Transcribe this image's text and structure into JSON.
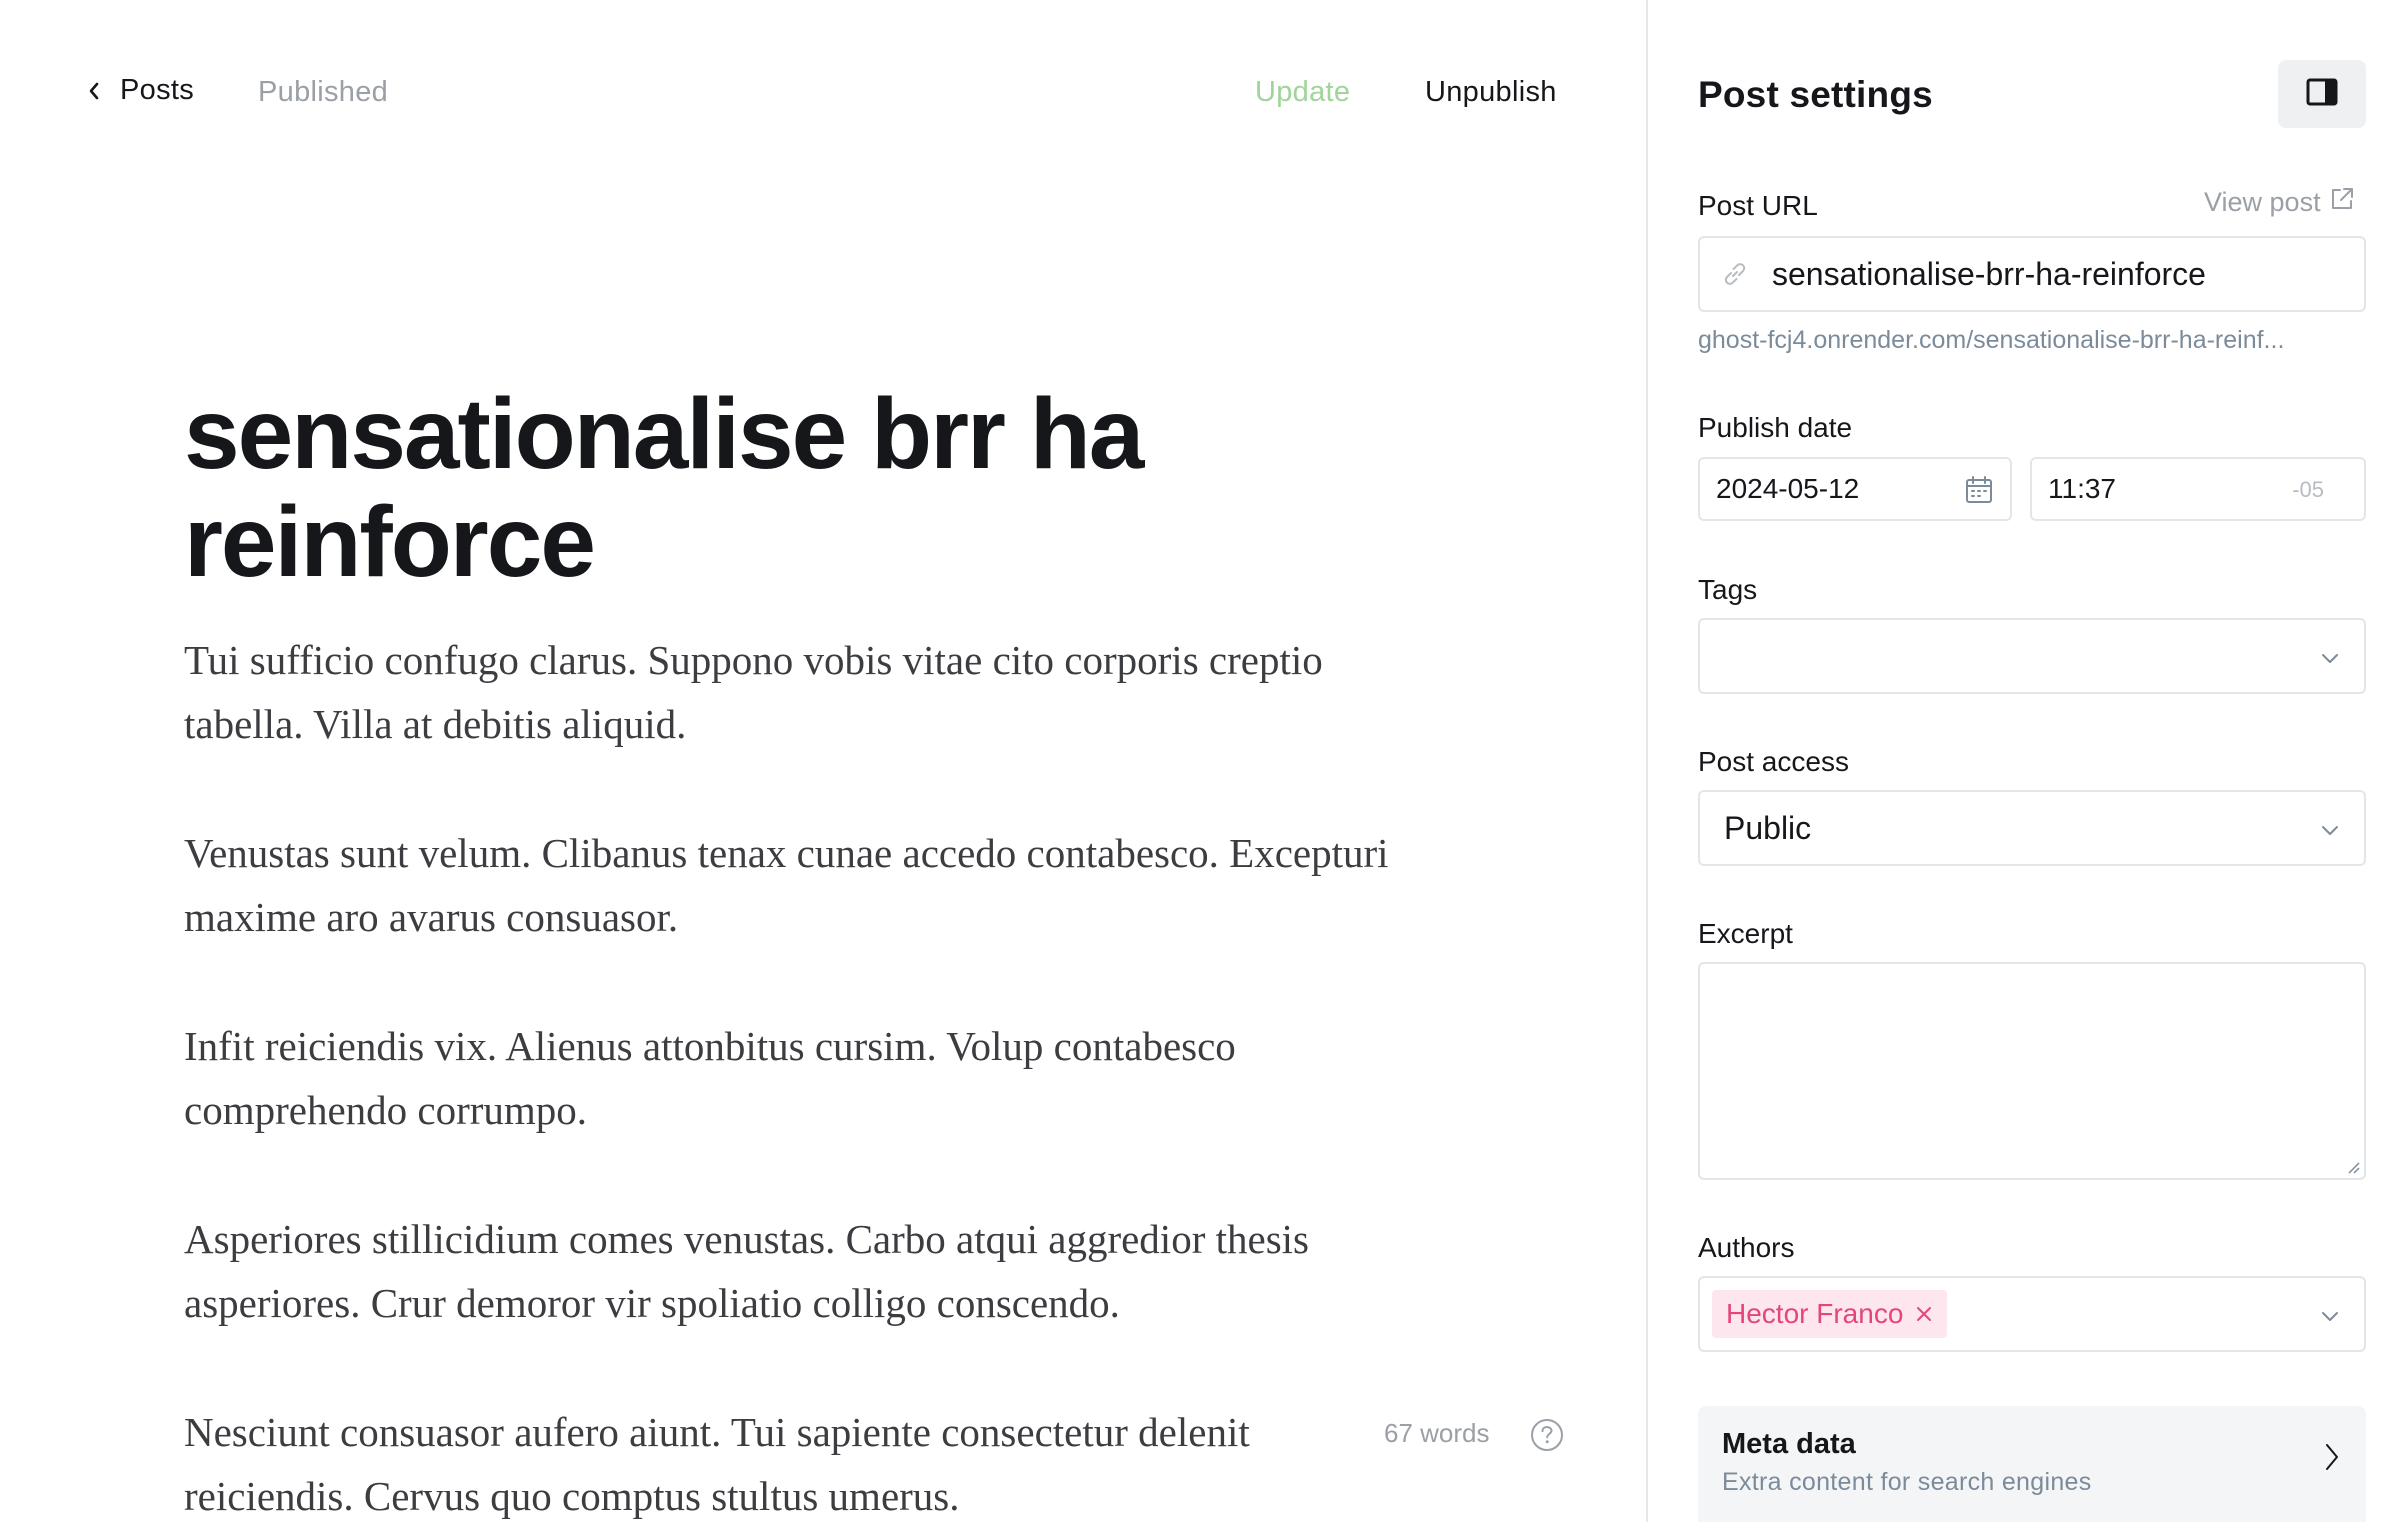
{
  "header": {
    "back_label": "Posts",
    "status": "Published",
    "update_label": "Update",
    "unpublish_label": "Unpublish"
  },
  "post": {
    "title": "sensationalise brr ha reinforce",
    "paragraphs": [
      "Tui sufficio confugo clarus. Suppono vobis vitae cito corporis creptio tabella. Villa at debitis aliquid.",
      "Venustas sunt velum. Clibanus tenax cunae accedo contabesco. Excepturi maxime aro avarus consuasor.",
      "Infit reiciendis vix. Alienus attonbitus cursim. Volup contabesco comprehendo corrumpo.",
      "Asperiores stillicidium comes venustas. Carbo atqui aggredior thesis asperiores. Crur demoror vir spoliatio colligo conscendo.",
      "Nesciunt consuasor aufero aiunt. Tui sapiente consectetur delenit reiciendis. Cervus quo comptus stultus umerus."
    ],
    "word_count": "67 words"
  },
  "sidebar": {
    "title": "Post settings",
    "url_label": "Post URL",
    "view_post_label": "View post",
    "slug": "sensationalise-brr-ha-reinforce",
    "full_url": "ghost-fcj4.onrender.com/sensationalise-brr-ha-reinf...",
    "publish_date_label": "Publish date",
    "date": "2024-05-12",
    "time": "11:37",
    "timezone": "-05",
    "tags_label": "Tags",
    "access_label": "Post access",
    "access_value": "Public",
    "excerpt_label": "Excerpt",
    "authors_label": "Authors",
    "author": "Hector Franco",
    "meta_title": "Meta data",
    "meta_subtitle": "Extra content for search engines"
  },
  "colors": {
    "update_green": "#9fd49a",
    "author_chip_bg": "#fde6ee",
    "author_chip_text": "#e4467b",
    "muted": "#9aa0a6"
  }
}
